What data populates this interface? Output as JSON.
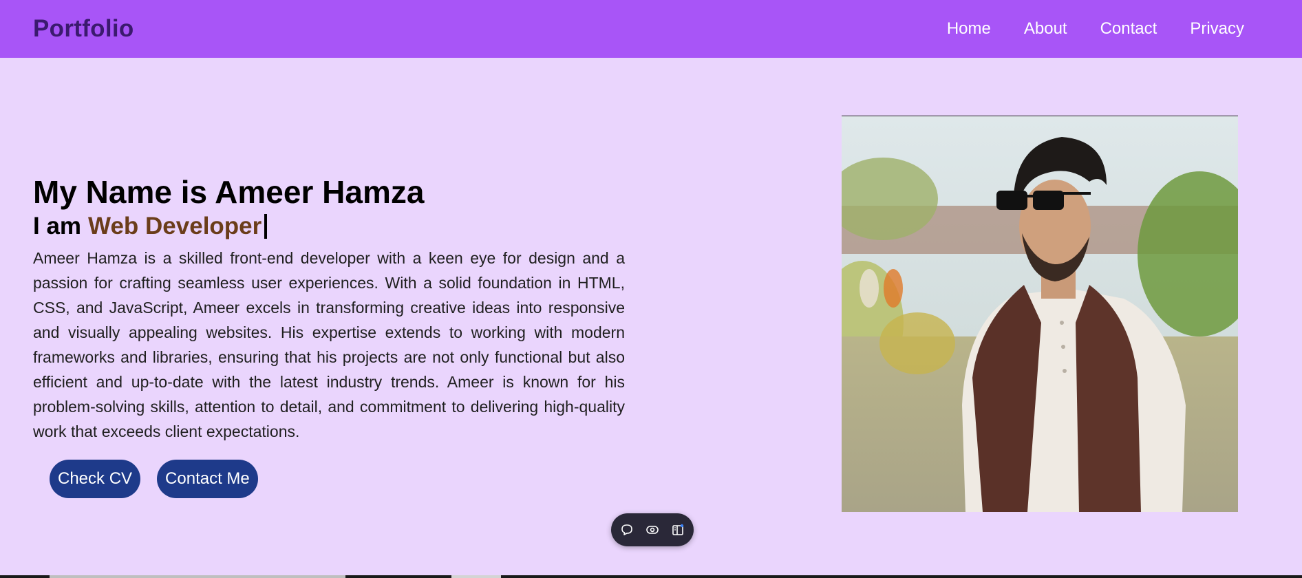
{
  "brand": "Portfolio",
  "nav": {
    "items": [
      "Home",
      "About",
      "Contact",
      "Privacy"
    ]
  },
  "hero": {
    "title": "My Name is Ameer Hamza",
    "subtitle_prefix": "I am",
    "role": "Web Developer",
    "bio": "Ameer Hamza is a skilled front-end developer with a keen eye for design and a passion for crafting seamless user experiences. With a solid foundation in HTML, CSS, and JavaScript, Ameer excels in transforming creative ideas into responsive and visually appealing websites. His expertise extends to working with modern frameworks and libraries, ensuring that his projects are not only functional but also efficient and up-to-date with the latest industry trends. Ameer is known for his problem-solving skills, attention to detail, and commitment to delivering high-quality work that exceeds client expectations."
  },
  "buttons": {
    "check_cv": "Check CV",
    "contact_me": "Contact Me"
  },
  "toolbar": {
    "icons": [
      "comment-icon",
      "eye-icon",
      "sidebar-panel-icon"
    ]
  },
  "colors": {
    "navbar": "#a855f7",
    "background": "#ead5fd",
    "brand_text": "#3b1a6e",
    "role_text": "#6b3d1a",
    "button": "#1e3a8a",
    "toolbar": "#2a2838"
  }
}
